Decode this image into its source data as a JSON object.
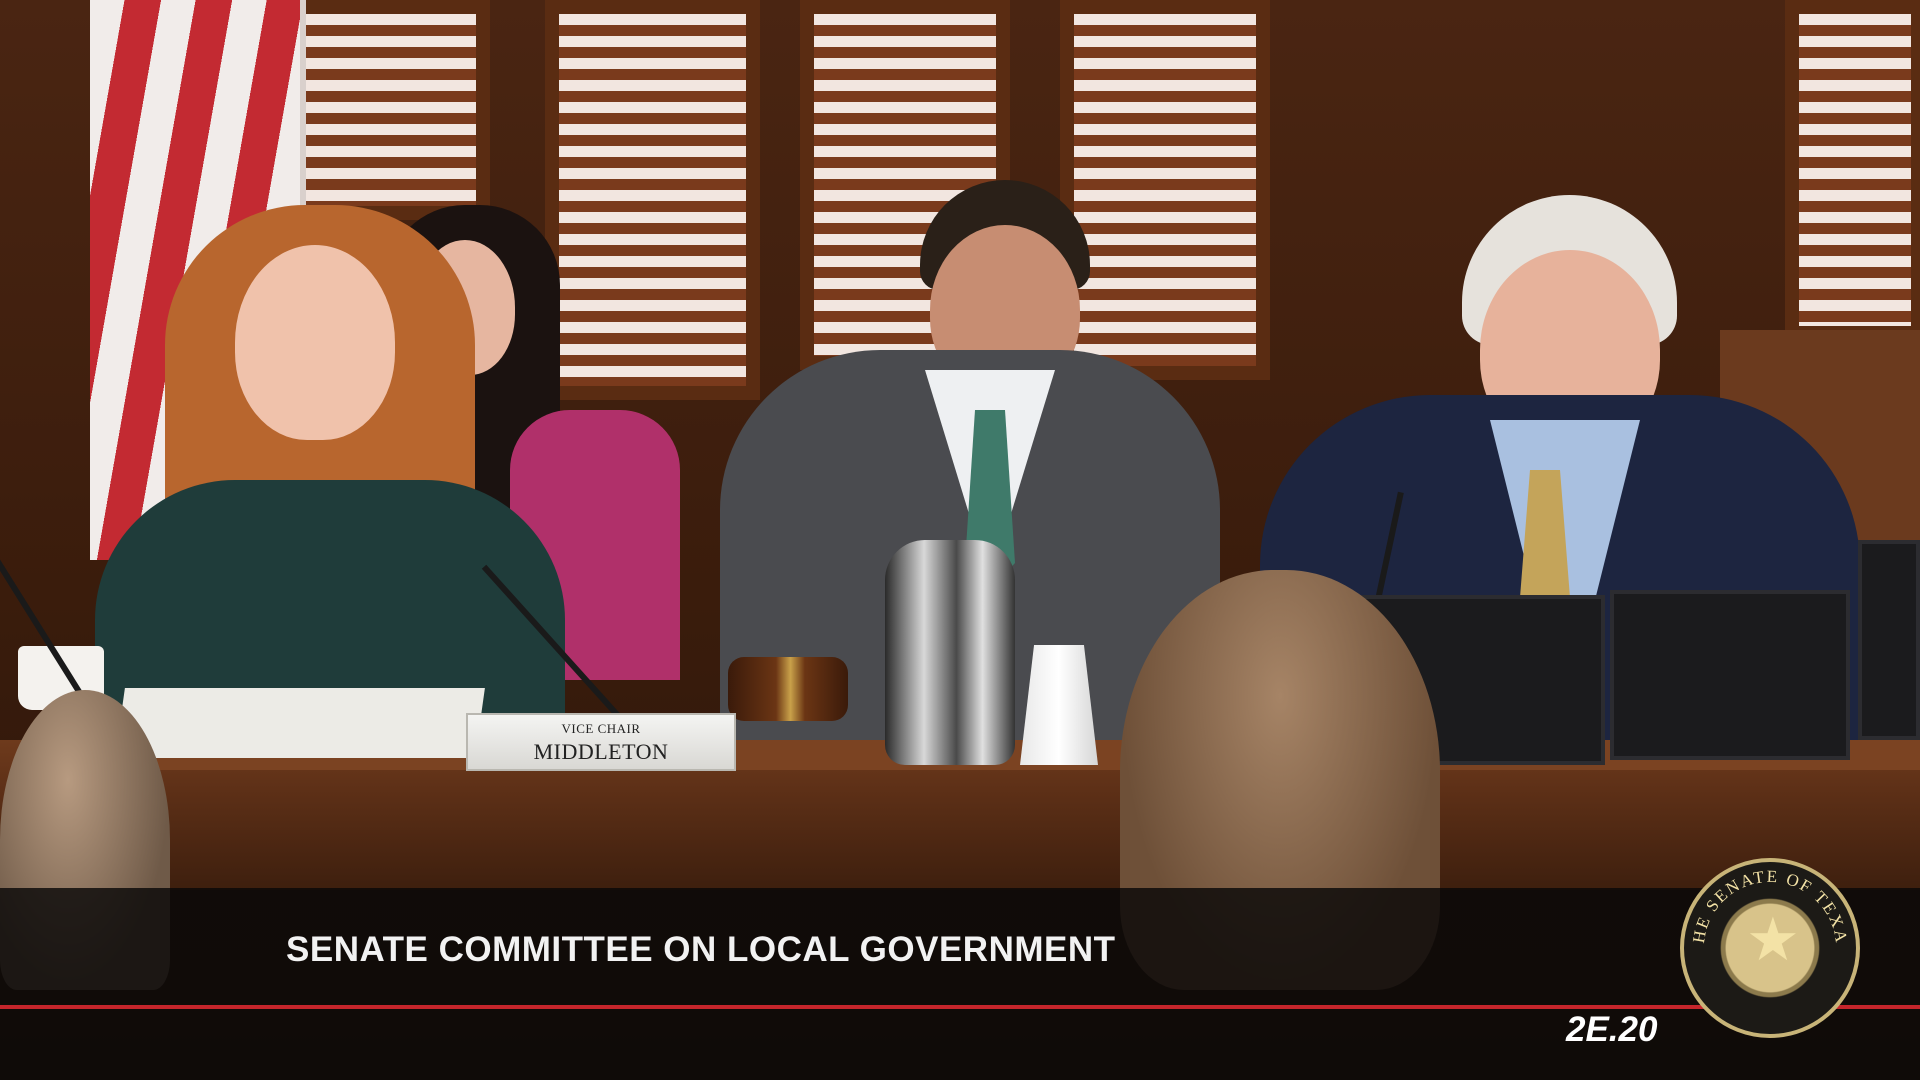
{
  "nameplate": {
    "small": "VICE CHAIR",
    "big": "MIDDLETON"
  },
  "lower_third": {
    "title": "SENATE COMMITTEE ON LOCAL GOVERNMENT",
    "code": "2E.20",
    "accent_color": "#c5252b"
  },
  "seal": {
    "icon": "senate-of-texas-seal-icon",
    "text": "THE SENATE OF TEXAS"
  }
}
